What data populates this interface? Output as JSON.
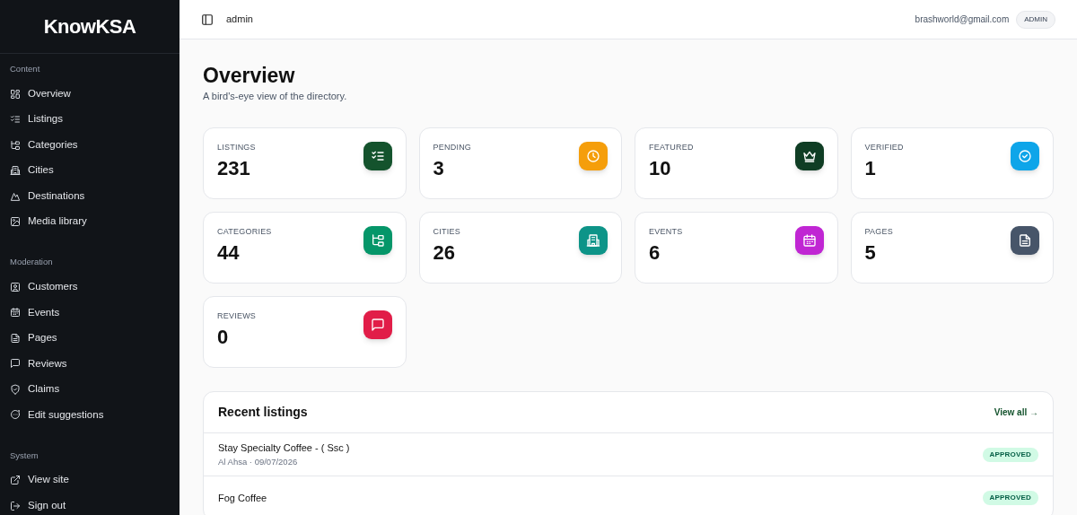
{
  "sidebar": {
    "logo": "KnowKSA",
    "sections": [
      {
        "title": "Content",
        "items": [
          {
            "label": "Overview",
            "kind": "grid",
            "selected": false
          },
          {
            "label": "Listings",
            "kind": "checklist",
            "selected": false
          },
          {
            "label": "Categories",
            "kind": "tree",
            "selected": false
          },
          {
            "label": "Cities",
            "kind": "building",
            "selected": false
          },
          {
            "label": "Destinations",
            "kind": "mountain",
            "selected": false
          },
          {
            "label": "Media library",
            "kind": "image",
            "selected": false
          }
        ]
      },
      {
        "title": "Moderation",
        "items": [
          {
            "label": "Customers",
            "kind": "user",
            "selected": false
          },
          {
            "label": "Events",
            "kind": "calendar",
            "selected": false
          },
          {
            "label": "Pages",
            "kind": "file",
            "selected": false
          },
          {
            "label": "Reviews",
            "kind": "message",
            "selected": false
          },
          {
            "label": "Claims",
            "kind": "shield",
            "selected": false
          },
          {
            "label": "Edit suggestions",
            "kind": "chat",
            "selected": false
          }
        ]
      },
      {
        "title": "System",
        "items": [
          {
            "label": "View site",
            "kind": "external",
            "selected": false
          },
          {
            "label": "Sign out",
            "kind": "logout",
            "selected": false
          }
        ]
      }
    ]
  },
  "topbar": {
    "breadcrumb": "admin",
    "email": "brashworld@gmail.com",
    "role": "ADMIN"
  },
  "header": {
    "title": "Overview",
    "subtitle": "A bird's-eye view of the directory."
  },
  "stats": [
    {
      "label": "LISTINGS",
      "value": "231",
      "kind": "checklist",
      "color": "#14532d"
    },
    {
      "label": "PENDING",
      "value": "3",
      "kind": "clock",
      "color": "#f59e0b"
    },
    {
      "label": "FEATURED",
      "value": "10",
      "kind": "crown",
      "color": "#0f3d24"
    },
    {
      "label": "VERIFIED",
      "value": "1",
      "kind": "badge",
      "color": "#0ea5e9"
    },
    {
      "label": "CATEGORIES",
      "value": "44",
      "kind": "tree",
      "color": "#059669"
    },
    {
      "label": "CITIES",
      "value": "26",
      "kind": "building",
      "color": "#0d9488"
    },
    {
      "label": "EVENTS",
      "value": "6",
      "kind": "calendar",
      "color": "#c026d3"
    },
    {
      "label": "PAGES",
      "value": "5",
      "kind": "file",
      "color": "#475569"
    },
    {
      "label": "REVIEWS",
      "value": "0",
      "kind": "message",
      "color": "#e11d48"
    }
  ],
  "recent": {
    "title": "Recent listings",
    "link": "View all →",
    "rows": [
      {
        "name": "Stay Specialty Coffee - ( Ssc )",
        "meta": "Al Ahsa · 09/07/2026",
        "status": "APPROVED"
      },
      {
        "name": "Fog Coffee",
        "status": "APPROVED"
      }
    ]
  }
}
